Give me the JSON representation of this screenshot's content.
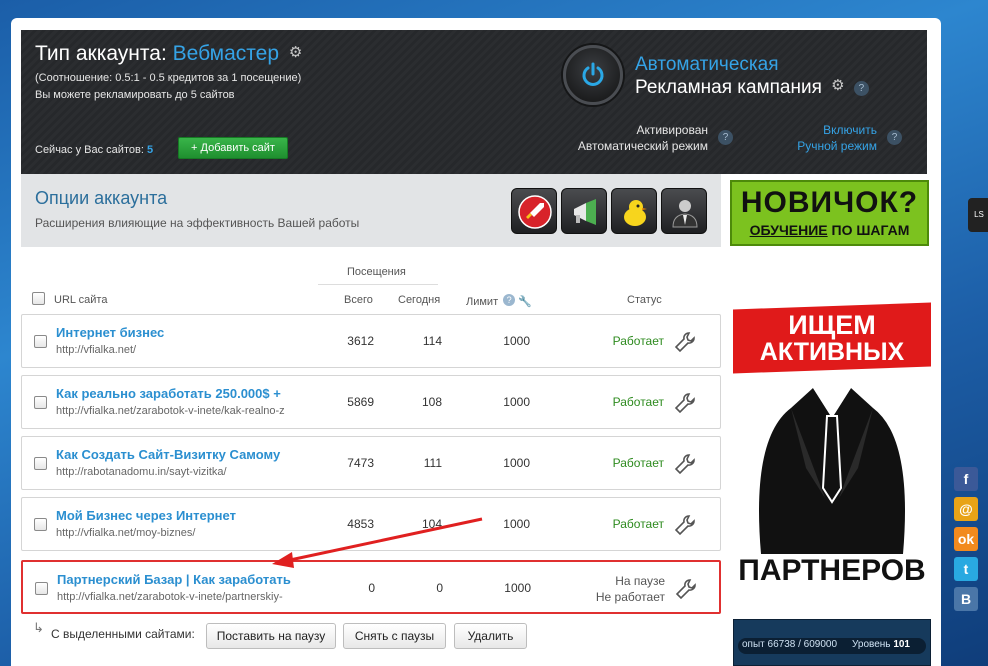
{
  "header": {
    "account_type_label": "Тип аккаунта:",
    "account_type_value": "Вебмастер",
    "ratio": "(Соотношение: 0.5:1 - 0.5 кредитов за 1 посещение)",
    "limit_info": "Вы можете рекламировать до 5 сайтов",
    "sites_now_label": "Сейчас у Вас сайтов:",
    "sites_now_count": "5",
    "add_site_button": "Добавить сайт",
    "campaign_line1": "Автоматическая",
    "campaign_line2": "Рекламная кампания",
    "activated_line1": "Активирован",
    "activated_line2": "Автоматический режим",
    "enable_line1": "Включить",
    "enable_line2": "Ручной режим"
  },
  "options": {
    "title": "Опции аккаунта",
    "subtitle": "Расширения влияющие на эффективность Вашей работы"
  },
  "novice_banner": {
    "line1": "НОВИЧОК?",
    "line2_underlined": "ОБУЧЕНИЕ",
    "line2_rest": " ПО ШАГАМ"
  },
  "table": {
    "visits_header": "Посещения",
    "col_url": "URL сайта",
    "col_total": "Всего",
    "col_today": "Сегодня",
    "col_limit": "Лимит",
    "col_status": "Статус",
    "rows": [
      {
        "title": "Интернет бизнес",
        "url": "http://vfialka.net/",
        "total": "3612",
        "today": "114",
        "limit": "1000",
        "status": "Работает"
      },
      {
        "title": "Как реально заработать 250.000$ +",
        "url": "http://vfialka.net/zarabotok-v-inete/kak-realno-z",
        "total": "5869",
        "today": "108",
        "limit": "1000",
        "status": "Работает"
      },
      {
        "title": "Как Создать Сайт-Визитку Самому",
        "url": "http://rabotanadomu.in/sayt-vizitka/",
        "total": "7473",
        "today": "111",
        "limit": "1000",
        "status": "Работает"
      },
      {
        "title": "Мой Бизнес через Интернет",
        "url": "http://vfialka.net/moy-biznes/",
        "total": "4853",
        "today": "104",
        "limit": "1000",
        "status": "Работает"
      },
      {
        "title": "Партнерский Базар | Как заработать",
        "url": "http://vfialka.net/zarabotok-v-inete/partnerskiy-",
        "total": "0",
        "today": "0",
        "limit": "1000",
        "status_line1": "На паузе",
        "status_line2": "Не работает"
      }
    ],
    "selected_label": "С выделенными сайтами:",
    "btn_pause": "Поставить на паузу",
    "btn_unpause": "Снять с паузы",
    "btn_delete": "Удалить"
  },
  "partners_banner": {
    "line1": "ИЩЕМ",
    "line2": "АКТИВНЫХ",
    "line3": "ПАРТНЕРОВ"
  },
  "level_bar": {
    "exp_label": "опыт 66738 / 609000",
    "level_label": "Уровень",
    "level_value": "101"
  },
  "side_tab": "LS",
  "colors": {
    "accent_blue": "#35a3e6",
    "status_green": "#2e8b1f",
    "highlight_red": "#e03030"
  }
}
